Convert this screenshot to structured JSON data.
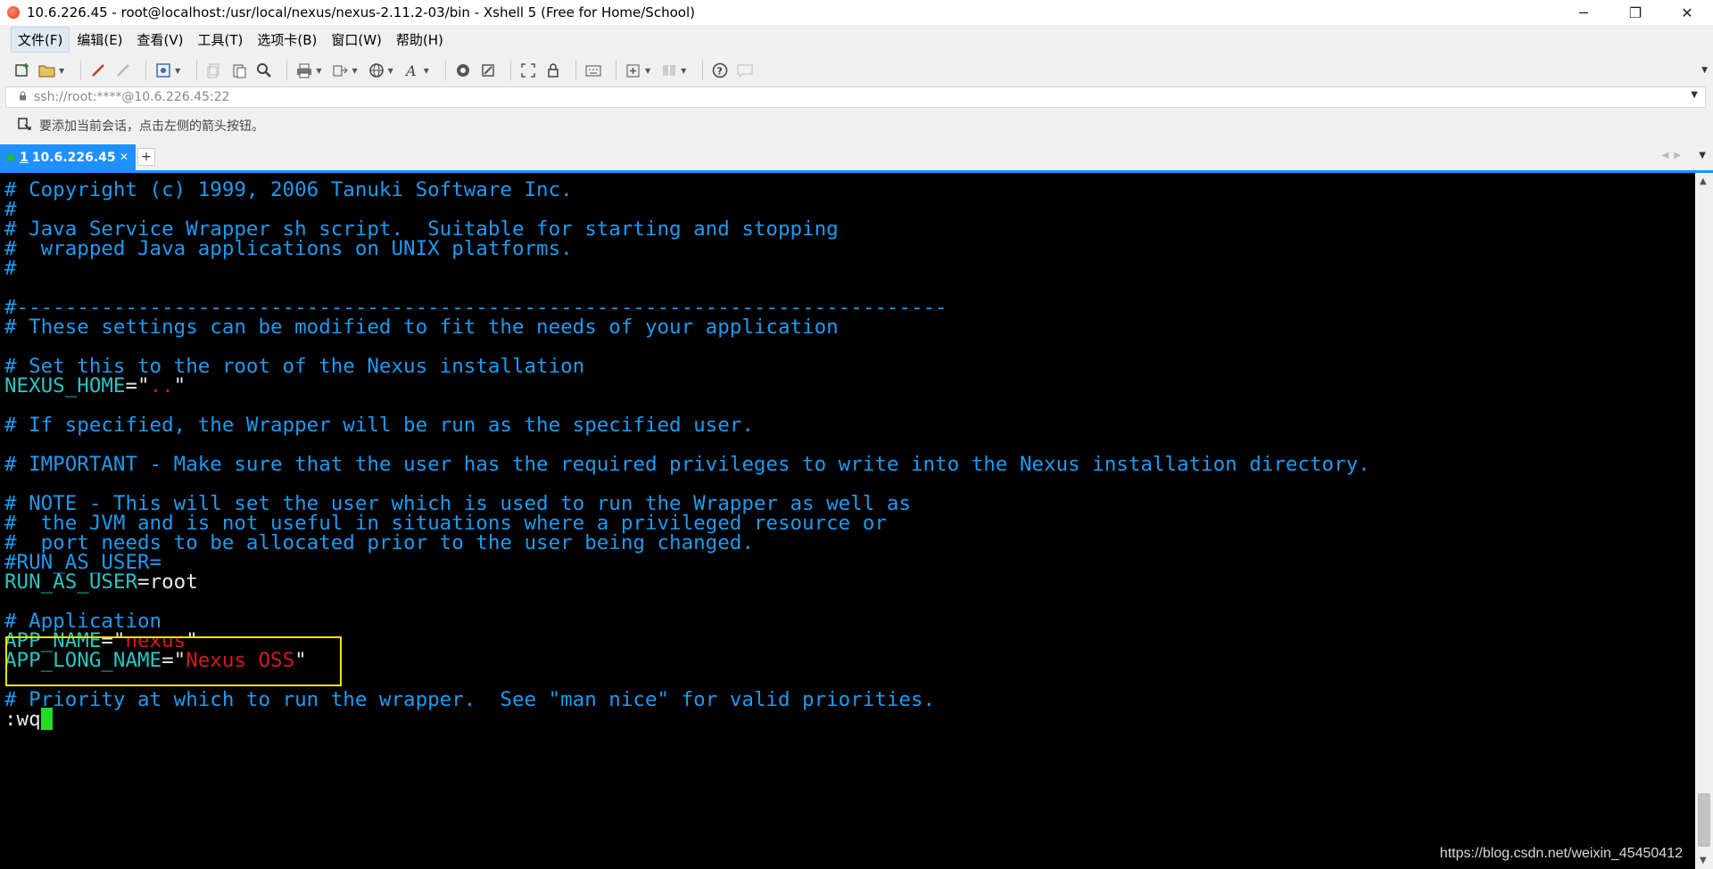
{
  "window": {
    "title": "10.6.226.45  - root@localhost:/usr/local/nexus/nexus-2.11.2-03/bin - Xshell 5 (Free for Home/School)",
    "controls": {
      "minimize": "─",
      "restore": "❐",
      "close": "✕"
    }
  },
  "menu": [
    {
      "label": "文件(F)"
    },
    {
      "label": "编辑(E)"
    },
    {
      "label": "查看(V)"
    },
    {
      "label": "工具(T)"
    },
    {
      "label": "选项卡(B)"
    },
    {
      "label": "窗口(W)"
    },
    {
      "label": "帮助(H)"
    }
  ],
  "address": {
    "value": "ssh://root:****@10.6.226.45:22"
  },
  "hint": {
    "text": "要添加当前会话，点击左侧的箭头按钮。"
  },
  "tabs": {
    "active": {
      "number": "1",
      "label": "10.6.226.45"
    }
  },
  "terminal": {
    "lines": [
      "# Copyright (c) 1999, 2006 Tanuki Software Inc.",
      "#",
      "# Java Service Wrapper sh script.  Suitable for starting and stopping",
      "#  wrapped Java applications on UNIX platforms.",
      "#",
      "",
      "#-----------------------------------------------------------------------------",
      "# These settings can be modified to fit the needs of your application",
      "",
      "# Set this to the root of the Nexus installation",
      "",
      "",
      "# If specified, the Wrapper will be run as the specified user.",
      "",
      "# IMPORTANT - Make sure that the user has the required privileges to write into the Nexus installation directory.",
      "",
      "# NOTE - This will set the user which is used to run the Wrapper as well as",
      "#  the JVM and is not useful in situations where a privileged resource or",
      "#  port needs to be allocated prior to the user being changed.",
      "#RUN_AS_USER=",
      "",
      "",
      "# Application",
      "",
      "",
      "",
      "# Priority at which to run the wrapper.  See \"man nice\" for valid priorities."
    ],
    "nexus_home": {
      "name": "NEXUS_HOME",
      "eq": "=\"",
      "value": "..",
      "close": "\""
    },
    "run_as_user": {
      "name": "RUN_AS_USER",
      "eq": "=",
      "value": "root"
    },
    "app_name": {
      "name": "APP_NAME",
      "eq": "=\"",
      "value": "nexus",
      "close": "\""
    },
    "app_long_name": {
      "name": "APP_LONG_NAME",
      "eq": "=\"",
      "value": "Nexus OSS",
      "close": "\""
    },
    "command": ":wq"
  },
  "watermark": "https://blog.csdn.net/weixin_45450412",
  "colors": {
    "comment": "#1d9bf0",
    "variable": "#28c6c6",
    "string": "#d01c1c",
    "cursor": "#22dd22",
    "highlight_box": "#f2e300",
    "tab_active": "#1e90ff"
  }
}
